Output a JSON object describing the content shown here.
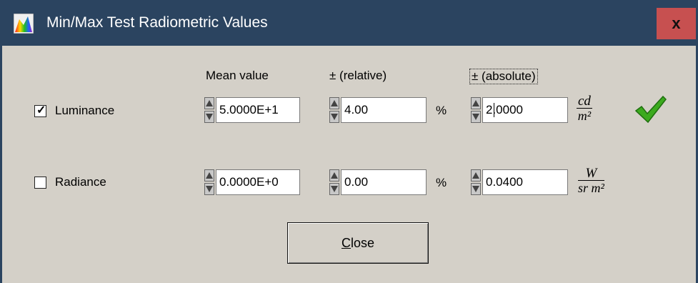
{
  "window": {
    "title": "Min/Max Test Radiometric Values",
    "close_glyph": "x",
    "icon": "spectrum-icon",
    "accent": "#2b4460",
    "close_color": "#c75050"
  },
  "headers": {
    "mean": "Mean value",
    "relative": "±  (relative)",
    "absolute": "±  (absolute)"
  },
  "rows": [
    {
      "label": "Luminance",
      "checked": true,
      "mean": "5.0000E+1",
      "relative": "4.00",
      "relative_unit": "%",
      "absolute": "2.0000",
      "unit_num": "cd",
      "unit_den": "m²"
    },
    {
      "label": "Radiance",
      "checked": false,
      "mean": "0.0000E+0",
      "relative": "0.00",
      "relative_unit": "%",
      "absolute": "0.0400",
      "unit_num": "W",
      "unit_den": "sr m²"
    }
  ],
  "close_button": {
    "mnemonic": "C",
    "rest": "lose"
  },
  "status_icon": "green-checkmark-icon",
  "checkmark_glyph": "✓"
}
